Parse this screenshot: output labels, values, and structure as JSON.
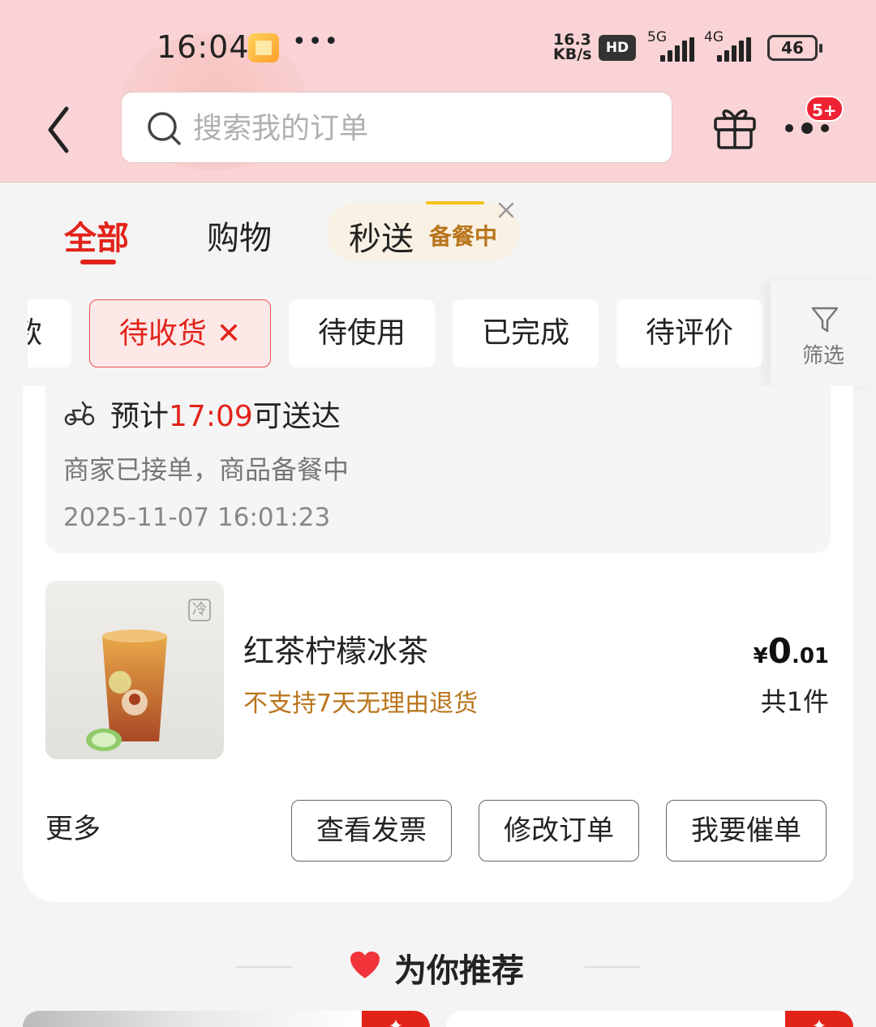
{
  "status_bar": {
    "time": "16:04",
    "dots": "•••",
    "speed_value": "16.3",
    "speed_unit": "KB/s",
    "hd": "HD",
    "sim1_label": "5G",
    "sim2_label": "4G",
    "battery": "46"
  },
  "header": {
    "search_placeholder": "搜索我的订单",
    "badge": "5+"
  },
  "tabs": {
    "all": "全部",
    "shopping": "购物",
    "express": "秒送",
    "express_status": "备餐中"
  },
  "filters": {
    "partial": "款",
    "pending_receipt": "待收货",
    "pending_use": "待使用",
    "completed": "已完成",
    "pending_review": "待评价",
    "filter": "筛选"
  },
  "order": {
    "eta_prefix": "预计",
    "eta_time": "17:09",
    "eta_suffix": "可送达",
    "status": "商家已接单，商品备餐中",
    "timestamp": "2025-11-07 16:01:23",
    "cold_tag": "冷",
    "product_name": "红茶柠檬冰茶",
    "product_note": "不支持7天无理由退货",
    "price_symbol": "¥",
    "price_int": "0",
    "price_dec": ".01",
    "quantity": "共1件",
    "more": "更多",
    "btn_invoice": "查看发票",
    "btn_modify": "修改订单",
    "btn_urge": "我要催单"
  },
  "recommend": {
    "title": "为你推荐"
  },
  "colors": {
    "accent_red": "#e2231a",
    "header_pink": "#f9d3d5",
    "brown_note": "#b9741b"
  }
}
